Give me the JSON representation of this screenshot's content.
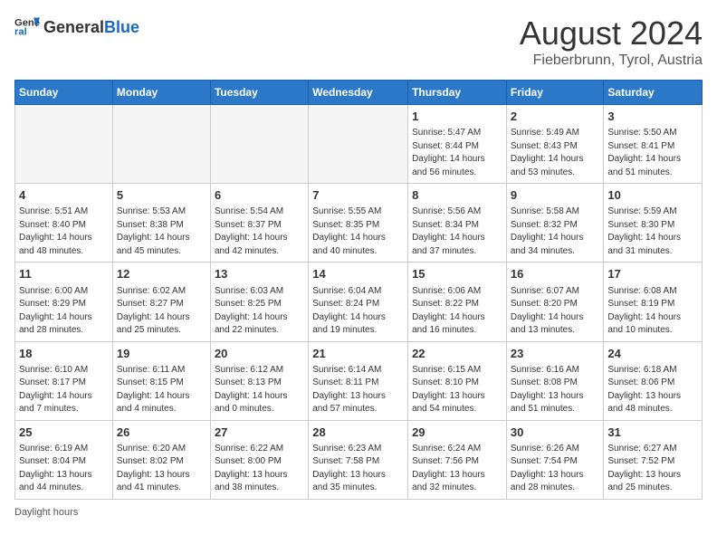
{
  "header": {
    "logo_line1": "General",
    "logo_line2": "Blue",
    "title": "August 2024",
    "subtitle": "Fieberbrunn, Tyrol, Austria"
  },
  "weekdays": [
    "Sunday",
    "Monday",
    "Tuesday",
    "Wednesday",
    "Thursday",
    "Friday",
    "Saturday"
  ],
  "weeks": [
    [
      {
        "day": "",
        "info": ""
      },
      {
        "day": "",
        "info": ""
      },
      {
        "day": "",
        "info": ""
      },
      {
        "day": "",
        "info": ""
      },
      {
        "day": "1",
        "info": "Sunrise: 5:47 AM\nSunset: 8:44 PM\nDaylight: 14 hours\nand 56 minutes."
      },
      {
        "day": "2",
        "info": "Sunrise: 5:49 AM\nSunset: 8:43 PM\nDaylight: 14 hours\nand 53 minutes."
      },
      {
        "day": "3",
        "info": "Sunrise: 5:50 AM\nSunset: 8:41 PM\nDaylight: 14 hours\nand 51 minutes."
      }
    ],
    [
      {
        "day": "4",
        "info": "Sunrise: 5:51 AM\nSunset: 8:40 PM\nDaylight: 14 hours\nand 48 minutes."
      },
      {
        "day": "5",
        "info": "Sunrise: 5:53 AM\nSunset: 8:38 PM\nDaylight: 14 hours\nand 45 minutes."
      },
      {
        "day": "6",
        "info": "Sunrise: 5:54 AM\nSunset: 8:37 PM\nDaylight: 14 hours\nand 42 minutes."
      },
      {
        "day": "7",
        "info": "Sunrise: 5:55 AM\nSunset: 8:35 PM\nDaylight: 14 hours\nand 40 minutes."
      },
      {
        "day": "8",
        "info": "Sunrise: 5:56 AM\nSunset: 8:34 PM\nDaylight: 14 hours\nand 37 minutes."
      },
      {
        "day": "9",
        "info": "Sunrise: 5:58 AM\nSunset: 8:32 PM\nDaylight: 14 hours\nand 34 minutes."
      },
      {
        "day": "10",
        "info": "Sunrise: 5:59 AM\nSunset: 8:30 PM\nDaylight: 14 hours\nand 31 minutes."
      }
    ],
    [
      {
        "day": "11",
        "info": "Sunrise: 6:00 AM\nSunset: 8:29 PM\nDaylight: 14 hours\nand 28 minutes."
      },
      {
        "day": "12",
        "info": "Sunrise: 6:02 AM\nSunset: 8:27 PM\nDaylight: 14 hours\nand 25 minutes."
      },
      {
        "day": "13",
        "info": "Sunrise: 6:03 AM\nSunset: 8:25 PM\nDaylight: 14 hours\nand 22 minutes."
      },
      {
        "day": "14",
        "info": "Sunrise: 6:04 AM\nSunset: 8:24 PM\nDaylight: 14 hours\nand 19 minutes."
      },
      {
        "day": "15",
        "info": "Sunrise: 6:06 AM\nSunset: 8:22 PM\nDaylight: 14 hours\nand 16 minutes."
      },
      {
        "day": "16",
        "info": "Sunrise: 6:07 AM\nSunset: 8:20 PM\nDaylight: 14 hours\nand 13 minutes."
      },
      {
        "day": "17",
        "info": "Sunrise: 6:08 AM\nSunset: 8:19 PM\nDaylight: 14 hours\nand 10 minutes."
      }
    ],
    [
      {
        "day": "18",
        "info": "Sunrise: 6:10 AM\nSunset: 8:17 PM\nDaylight: 14 hours\nand 7 minutes."
      },
      {
        "day": "19",
        "info": "Sunrise: 6:11 AM\nSunset: 8:15 PM\nDaylight: 14 hours\nand 4 minutes."
      },
      {
        "day": "20",
        "info": "Sunrise: 6:12 AM\nSunset: 8:13 PM\nDaylight: 14 hours\nand 0 minutes."
      },
      {
        "day": "21",
        "info": "Sunrise: 6:14 AM\nSunset: 8:11 PM\nDaylight: 13 hours\nand 57 minutes."
      },
      {
        "day": "22",
        "info": "Sunrise: 6:15 AM\nSunset: 8:10 PM\nDaylight: 13 hours\nand 54 minutes."
      },
      {
        "day": "23",
        "info": "Sunrise: 6:16 AM\nSunset: 8:08 PM\nDaylight: 13 hours\nand 51 minutes."
      },
      {
        "day": "24",
        "info": "Sunrise: 6:18 AM\nSunset: 8:06 PM\nDaylight: 13 hours\nand 48 minutes."
      }
    ],
    [
      {
        "day": "25",
        "info": "Sunrise: 6:19 AM\nSunset: 8:04 PM\nDaylight: 13 hours\nand 44 minutes."
      },
      {
        "day": "26",
        "info": "Sunrise: 6:20 AM\nSunset: 8:02 PM\nDaylight: 13 hours\nand 41 minutes."
      },
      {
        "day": "27",
        "info": "Sunrise: 6:22 AM\nSunset: 8:00 PM\nDaylight: 13 hours\nand 38 minutes."
      },
      {
        "day": "28",
        "info": "Sunrise: 6:23 AM\nSunset: 7:58 PM\nDaylight: 13 hours\nand 35 minutes."
      },
      {
        "day": "29",
        "info": "Sunrise: 6:24 AM\nSunset: 7:56 PM\nDaylight: 13 hours\nand 32 minutes."
      },
      {
        "day": "30",
        "info": "Sunrise: 6:26 AM\nSunset: 7:54 PM\nDaylight: 13 hours\nand 28 minutes."
      },
      {
        "day": "31",
        "info": "Sunrise: 6:27 AM\nSunset: 7:52 PM\nDaylight: 13 hours\nand 25 minutes."
      }
    ]
  ],
  "footer": "Daylight hours"
}
